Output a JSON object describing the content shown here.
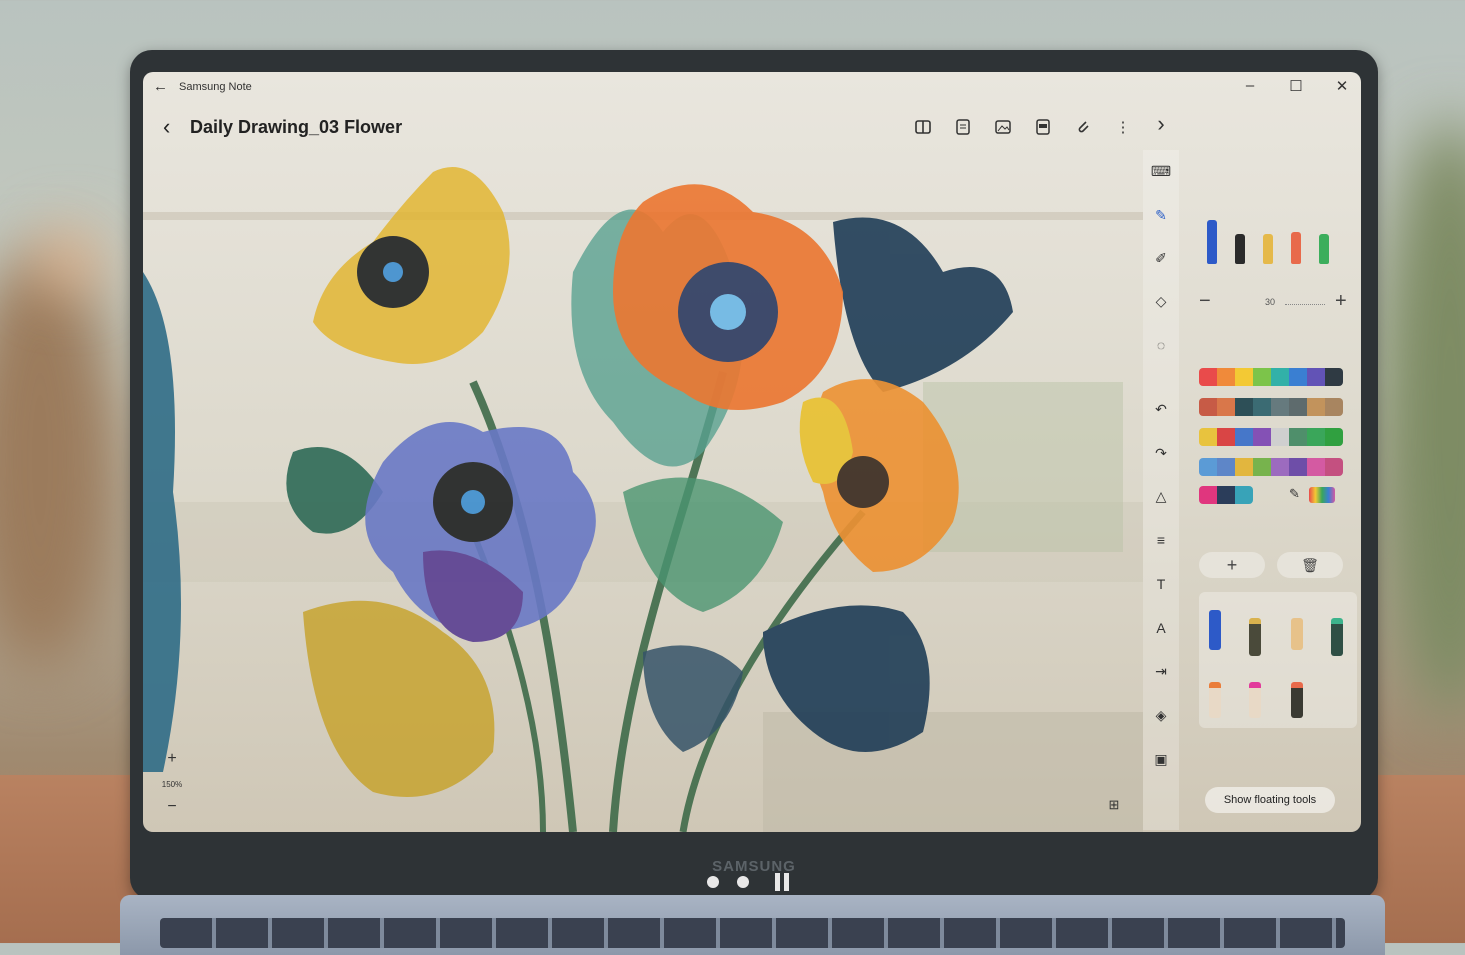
{
  "window": {
    "app_title": "Samsung Note",
    "minimize_glyph": "–",
    "maximize_glyph": "☐",
    "close_glyph": "✕",
    "back_glyph": "←"
  },
  "header": {
    "back_glyph": "‹",
    "doc_title": "Daily Drawing_03 Flower",
    "icons": [
      "book-view-icon",
      "page-layout-icon",
      "image-icon",
      "pdf-icon",
      "attach-icon",
      "more-icon"
    ],
    "more_glyph": "⋮",
    "collapse_glyph": "›"
  },
  "toolbar": {
    "tools": [
      "keyboard-icon",
      "pen-icon",
      "highlighter-icon",
      "eraser-icon",
      "lasso-icon",
      "undo-icon",
      "redo-icon",
      "shape-icon",
      "text-align-icon",
      "text-style-icon",
      "font-icon",
      "insert-icon",
      "mask-icon",
      "paste-icon"
    ]
  },
  "pen_panel": {
    "size_value": "30",
    "minus_glyph": "−",
    "plus_glyph": "+",
    "add_glyph": "+",
    "delete_glyph": "🗑",
    "palette": [
      [
        "#e94b4b",
        "#f08a3a",
        "#f3c934",
        "#7cc44a",
        "#32b1a8",
        "#3a7fd2",
        "#6253b6",
        "#2f3a43"
      ],
      [
        "#c75b46",
        "#d9774a",
        "#2d4f57",
        "#3b6b73",
        "#667a7e",
        "#5e6b6d",
        "#c2935c",
        "#a88560"
      ],
      [
        "#e8c33e",
        "#d94545",
        "#4677c9",
        "#8451b5",
        "#cfcfcf",
        "#4f8f6b",
        "#3aa65a",
        "#30a040"
      ],
      [
        "#5b9bd6",
        "#5e86c8",
        "#e2b63e",
        "#77b34d",
        "#9c6bbf",
        "#6e4ea8",
        "#d45aa2",
        "#c45080"
      ],
      [
        "#e0367e",
        "#2b3d5a",
        "#38a3b8"
      ]
    ]
  },
  "floating_tools_label": "Show floating tools",
  "zoom": {
    "value": "150%",
    "plus": "+",
    "minus": "−"
  },
  "bezel_brand": "SAMSUNG"
}
